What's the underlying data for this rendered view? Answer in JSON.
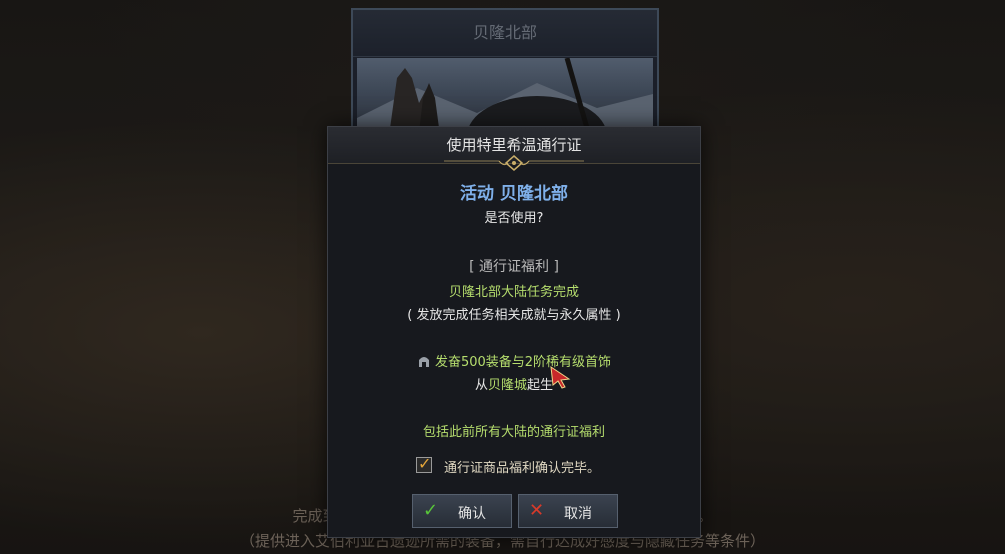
{
  "background": {
    "region_card_title": "贝隆北部",
    "bottom_line1": "完成到贝隆北部大陆为止的所有任务，可前往艾伯利亚古遗迹。",
    "bottom_line2": "（提供进入艾伯利亚古遗迹所需的装备，需自行达成好感度与隐藏任务等条件）"
  },
  "dialog": {
    "title": "使用特里希温通行证",
    "activity": "活动 贝隆北部",
    "question": "是否使用?",
    "benefit_header": "[ 通行证福利 ]",
    "line_complete": "贝隆北部大陆任务完成",
    "line_unlock": "( 发放完成任务相关成就与永久属性 )",
    "line_gear": "发奋500装备与2阶稀有级首饰",
    "line_start_prefix": "从",
    "line_start_city": "贝隆城",
    "line_start_suffix": "起生",
    "line_include": "包括此前所有大陆的通行证福利",
    "checkbox": {
      "label": "通行证商品福利确认完毕。",
      "checked": true
    },
    "confirm_button": "确认",
    "cancel_button": "取消"
  },
  "colors": {
    "activity_blue": "#7fb0ea",
    "benefit_green": "#b6de6e",
    "check_orange": "#e4a63a"
  }
}
